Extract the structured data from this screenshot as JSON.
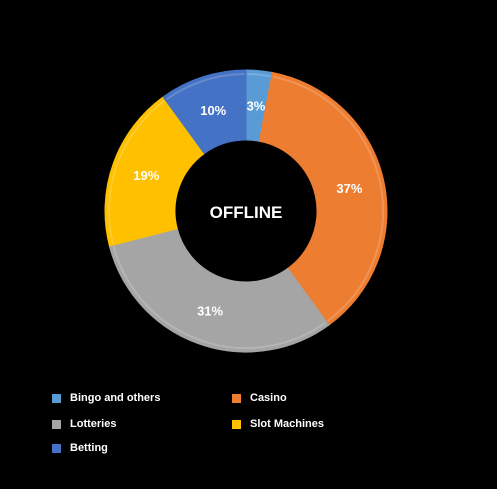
{
  "chart_data": {
    "type": "pie",
    "subtype": "donut",
    "center_text": "OFFLINE",
    "categories": [
      "Bingo and others",
      "Casino",
      "Lotteries",
      "Slot Machines",
      "Betting"
    ],
    "values": [
      3,
      37,
      31,
      19,
      10
    ],
    "value_labels": [
      "3%",
      "37%",
      "31%",
      "19%",
      "10%"
    ],
    "colors": [
      "#5B9BD5",
      "#ED7D31",
      "#A5A5A5",
      "#FFC000",
      "#4472C4"
    ],
    "legend": {
      "placement": "bottom",
      "entries": [
        {
          "label": "Bingo and others",
          "color": "#5B9BD5"
        },
        {
          "label": "Casino",
          "color": "#ED7D31"
        },
        {
          "label": "Lotteries",
          "color": "#A5A5A5"
        },
        {
          "label": "Slot Machines",
          "color": "#FFC000"
        },
        {
          "label": "Betting",
          "color": "#4472C4"
        }
      ]
    }
  }
}
